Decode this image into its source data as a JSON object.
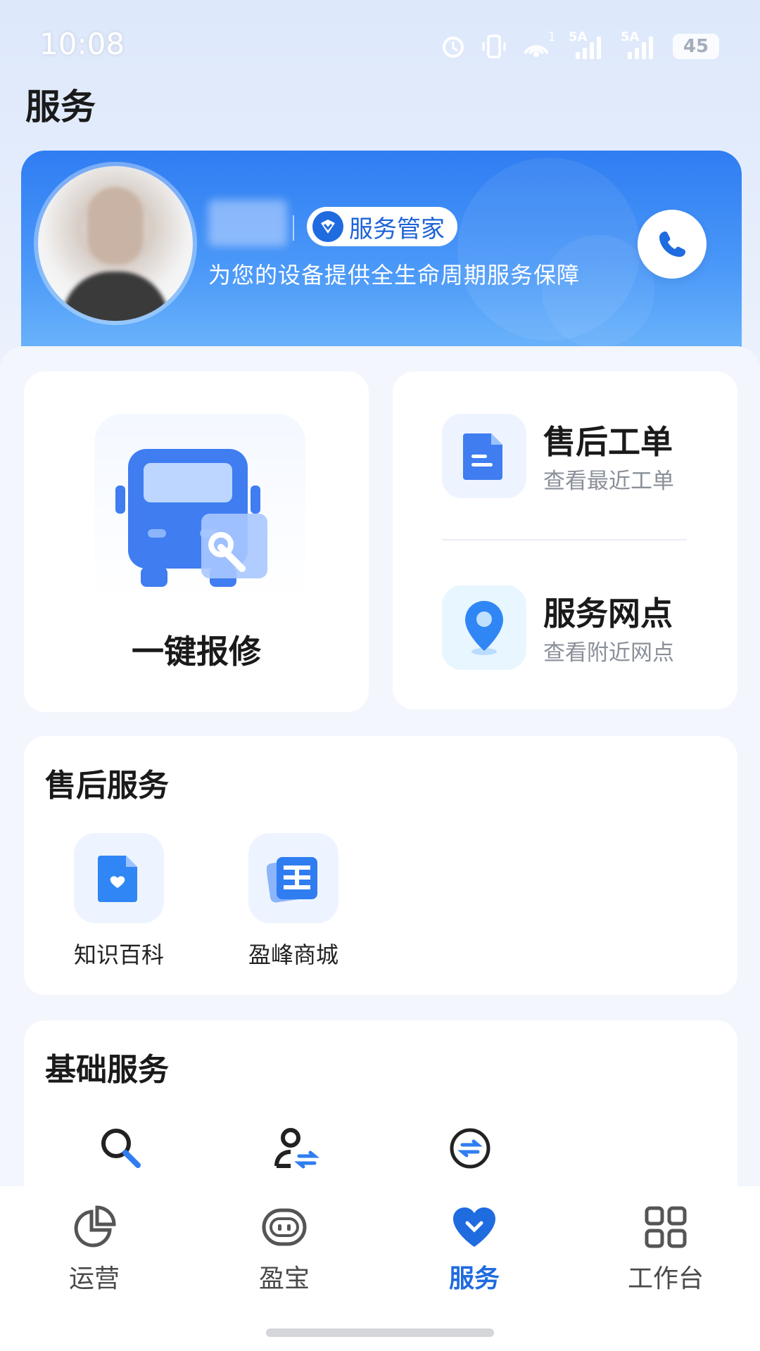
{
  "status_bar": {
    "time": "10:08",
    "net1": "5A",
    "net2": "5A",
    "wifi_badge": "1",
    "battery": "45",
    "icons": [
      "alarm-icon",
      "vibrate-icon",
      "hotspot-icon",
      "signal-icon",
      "signal-icon",
      "battery-icon"
    ]
  },
  "page": {
    "title": "服务"
  },
  "hero": {
    "badge_label": "服务管家",
    "subtitle": "为您的设备提供全生命周期服务保障",
    "accent": "#2f7df2"
  },
  "quick": {
    "repair_label": "一键报修",
    "orders_title": "售后工单",
    "orders_sub": "查看最近工单",
    "outlets_title": "服务网点",
    "outlets_sub": "查看附近网点"
  },
  "after_sales": {
    "title": "售后服务",
    "items": [
      {
        "label": "知识百科",
        "icon": "knowledge-icon"
      },
      {
        "label": "盈峰商城",
        "icon": "mall-icon"
      }
    ]
  },
  "basic": {
    "title": "基础服务",
    "icons": [
      "search-key-icon",
      "user-switch-icon",
      "exchange-icon"
    ]
  },
  "tabs": [
    {
      "label": "运营",
      "icon": "pie-chart-icon"
    },
    {
      "label": "盈宝",
      "icon": "robot-icon"
    },
    {
      "label": "服务",
      "icon": "heart-icon",
      "active": true
    },
    {
      "label": "工作台",
      "icon": "grid-icon"
    }
  ],
  "colors": {
    "brand": "#1f6be0",
    "tab_active": "#1f6be0"
  }
}
